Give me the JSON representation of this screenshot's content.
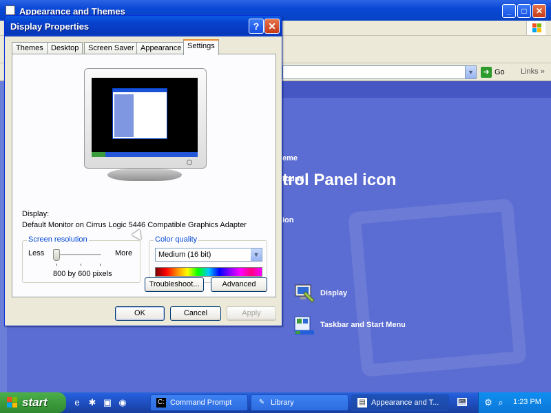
{
  "background_window": {
    "title": "Appearance and Themes",
    "address": {
      "go_label": "Go",
      "links_label": "Links"
    },
    "tasks": [
      "eme",
      "round",
      "ion"
    ],
    "heading": "trol Panel icon",
    "icons": [
      {
        "label": "Display",
        "icon": "display-icon"
      },
      {
        "label": "Taskbar and Start Menu",
        "icon": "taskbar-start-menu-icon"
      }
    ]
  },
  "dialog": {
    "title": "Display Properties",
    "help_glyph": "?",
    "close_glyph": "✕",
    "tabs": [
      {
        "label": "Themes",
        "active": false
      },
      {
        "label": "Desktop",
        "active": false
      },
      {
        "label": "Screen Saver",
        "active": false
      },
      {
        "label": "Appearance",
        "active": false
      },
      {
        "label": "Settings",
        "active": true
      }
    ],
    "display_label": "Display:",
    "display_device": "Default Monitor on Cirrus Logic 5446 Compatible Graphics Adapter",
    "screen_resolution": {
      "legend": "Screen resolution",
      "less_label": "Less",
      "more_label": "More",
      "value": "800 by 600 pixels",
      "slider_position": 0
    },
    "color_quality": {
      "legend": "Color quality",
      "selected": "Medium (16 bit)"
    },
    "buttons": {
      "troubleshoot": "Troubleshoot...",
      "advanced": "Advanced",
      "ok": "OK",
      "cancel": "Cancel",
      "apply": "Apply"
    }
  },
  "taskbar": {
    "start_label": "start",
    "tasks": [
      {
        "label": "Command Prompt",
        "active": false
      },
      {
        "label": "Library",
        "active": false
      },
      {
        "label": "Appearance and T...",
        "active": true
      }
    ],
    "clock": "1:23 PM"
  },
  "colors": {
    "xp_blue": "#0842c4",
    "dialog_face": "#ece9d8",
    "tab_accent": "#e68b2c",
    "start_green": "#3c9b3c",
    "content_blue": "#5b6cd2"
  }
}
